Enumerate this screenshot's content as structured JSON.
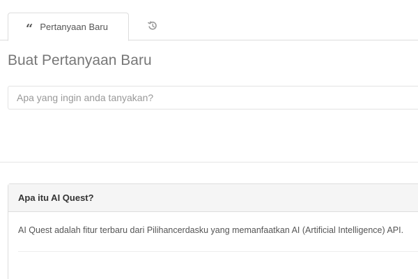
{
  "tabs": {
    "new_question_label": "Pertanyaan Baru",
    "new_question_icon": "quote-icon",
    "history_icon": "history-icon"
  },
  "page": {
    "title": "Buat Pertanyaan Baru"
  },
  "question_input": {
    "placeholder": "Apa yang ingin anda tanyakan?",
    "value": ""
  },
  "info_panel": {
    "title": "Apa itu AI Quest?",
    "body": "AI Quest adalah fitur terbaru dari Pilihancerdasku yang memanfaatkan AI (Artificial Intelligence) API."
  },
  "colors": {
    "text": "#555555",
    "border": "#dddddd",
    "panel_heading_bg": "#f5f5f5"
  }
}
